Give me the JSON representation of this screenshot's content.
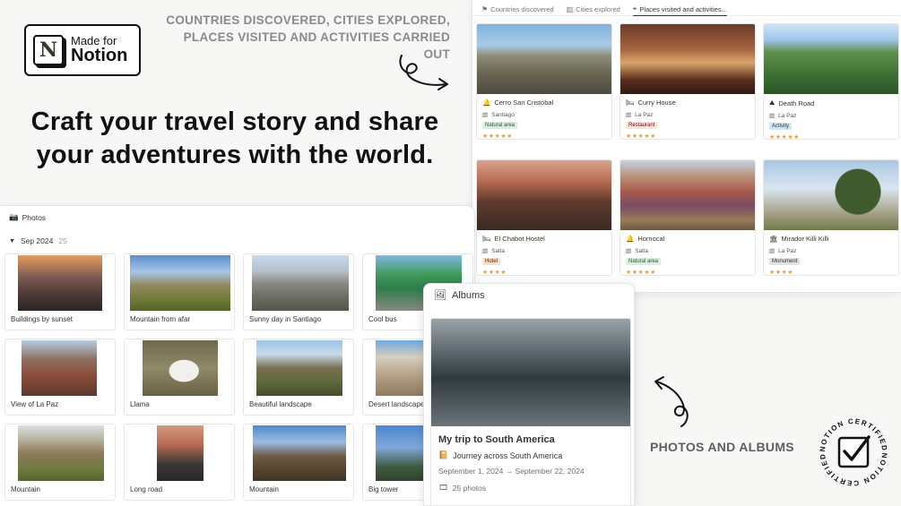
{
  "badge": {
    "logo_letter": "N",
    "small": "Made for",
    "big": "Notion"
  },
  "headline": "Craft your travel story and share your adventures with the world.",
  "tagline_top": "COUNTRIES DISCOVERED, CITIES EXPLORED, PLACES VISITED AND ACTIVITIES CARRIED OUT",
  "tagline_bottom": "PHOTOS AND ALBUMS",
  "places": {
    "tabs": [
      {
        "icon": "flag-icon",
        "label": "Countries discovered",
        "active": false
      },
      {
        "icon": "city-icon",
        "label": "Cities explored",
        "active": false
      },
      {
        "icon": "pin-icon",
        "label": "Places visited and activities...",
        "active": true
      }
    ],
    "cards": [
      {
        "title": "Cerro San Cristóbal",
        "city": "Santiago",
        "tag": "Natural area",
        "tag_bg": "#dbeddb",
        "tag_fg": "#2b593f",
        "stars": "★★★★★"
      },
      {
        "title": "Curry House",
        "city": "La Paz",
        "tag": "Restaurant",
        "tag_bg": "#ffe2dd",
        "tag_fg": "#5d1715",
        "stars": "★★★★★"
      },
      {
        "title": "Death Road",
        "city": "La Paz",
        "tag": "Activity",
        "tag_bg": "#d3e5ef",
        "tag_fg": "#183347",
        "stars": "★★★★★"
      },
      {
        "title": "El Chabot Hostel",
        "city": "Salta",
        "tag": "Hotel",
        "tag_bg": "#fadec9",
        "tag_fg": "#49290e",
        "stars": "★★★★"
      },
      {
        "title": "Hornocal",
        "city": "Salta",
        "tag": "Natural area",
        "tag_bg": "#dbeddb",
        "tag_fg": "#2b593f",
        "stars": "★★★★★"
      },
      {
        "title": "Mirador Killi Killi",
        "city": "La Paz",
        "tag": "Monument",
        "tag_bg": "#e3e2e0",
        "tag_fg": "#32302c",
        "stars": "★★★★"
      }
    ]
  },
  "photos": {
    "header": "Photos",
    "group_label": "Sep 2024",
    "group_count": "25",
    "items": [
      {
        "label": "Buildings by sunset"
      },
      {
        "label": "Mountain from afar"
      },
      {
        "label": "Sunny day in Santiago"
      },
      {
        "label": "Cool bus"
      },
      {
        "label": "View of La Paz"
      },
      {
        "label": "Llama"
      },
      {
        "label": "Beautiful landscape"
      },
      {
        "label": "Desert landscape"
      },
      {
        "label": "Mountain"
      },
      {
        "label": "Long road"
      },
      {
        "label": "Mountain"
      },
      {
        "label": "Big tower"
      }
    ]
  },
  "albums": {
    "header": "Albums",
    "title": "My trip to South America",
    "linked": "Journey across South America",
    "dates": "September 1, 2024 → September 22, 2024",
    "count": "25 photos"
  },
  "seal": {
    "top": "NOTION CERTIFIED",
    "bottom": "NOTION CERTIFIED"
  }
}
